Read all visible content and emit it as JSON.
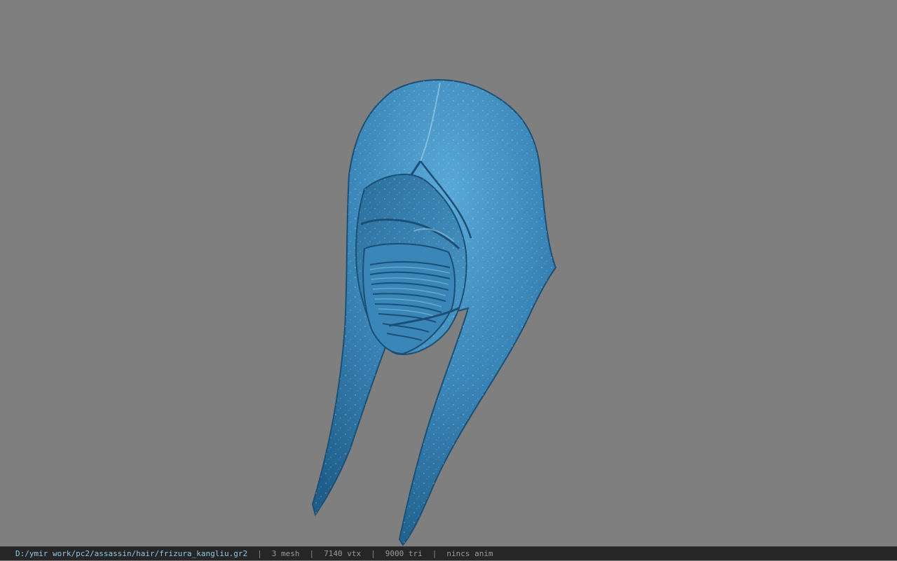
{
  "viewer": {
    "background_color": "#7f7f7f",
    "model_color": "#3f8fbf",
    "model_icon": "hooded-mask-model"
  },
  "status": {
    "file_path": "D:/ymir work/pc2/assassin/hair/frizura_kangliu.gr2",
    "separator": "|",
    "mesh": "3 mesh",
    "vtx": "7140 vtx",
    "tri": "9000 tri",
    "anim": "nincs anim"
  }
}
